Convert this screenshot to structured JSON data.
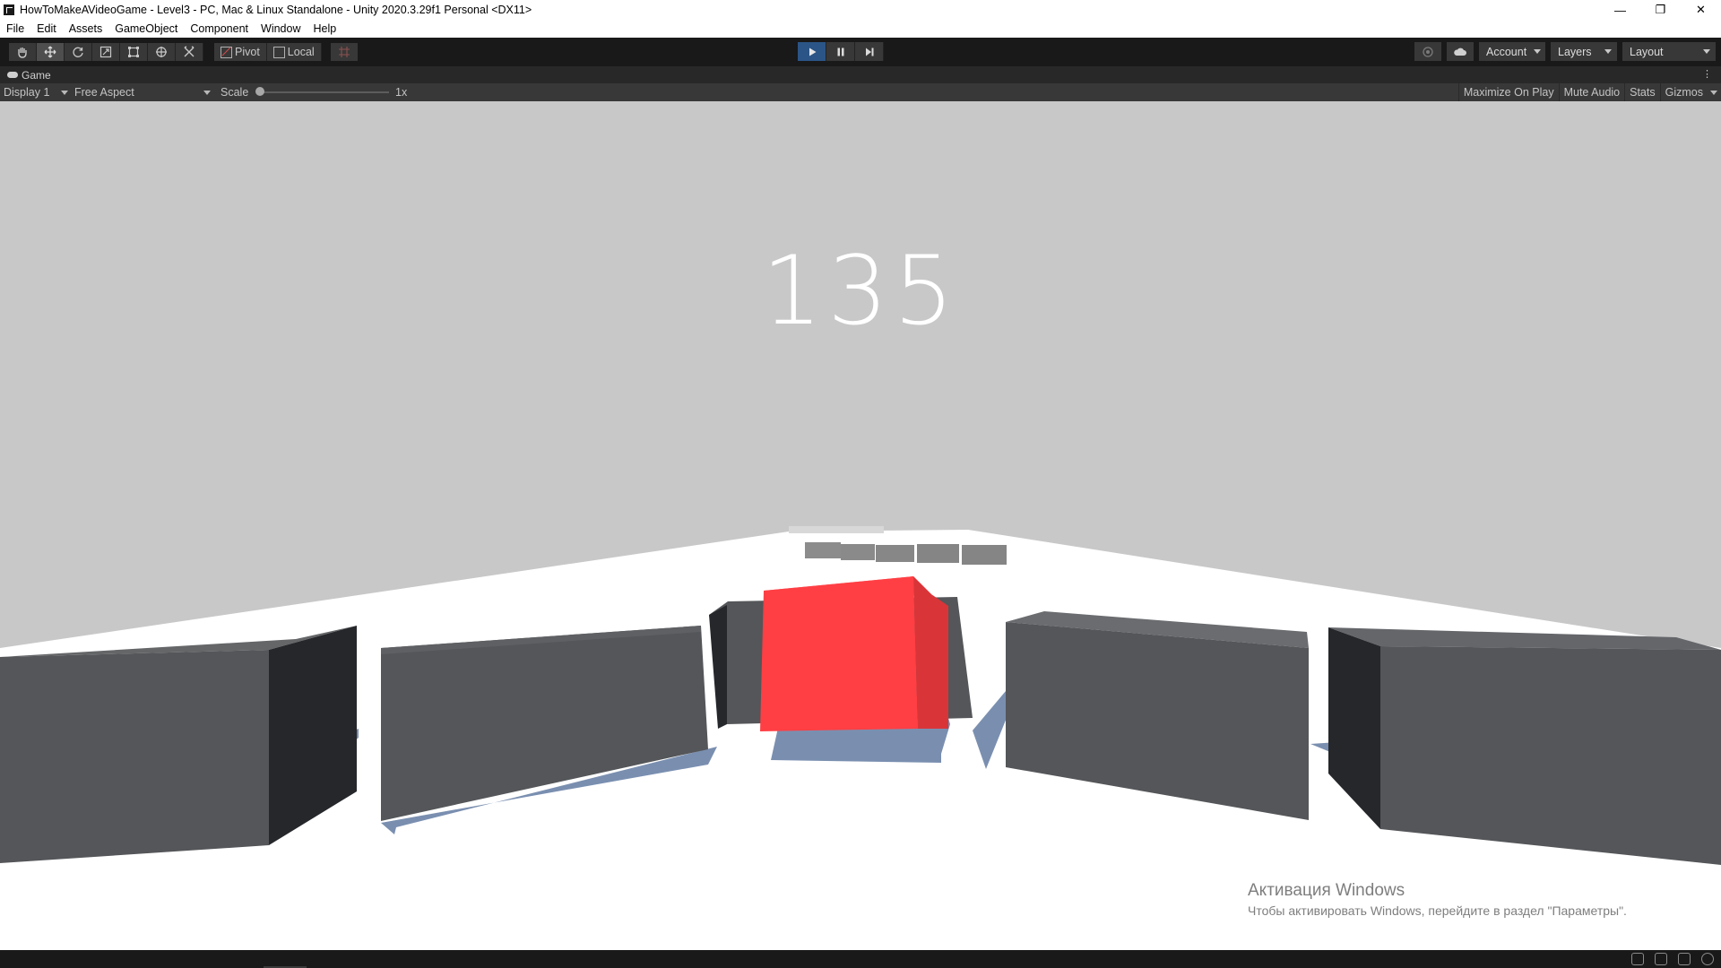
{
  "window": {
    "title": "HowToMakeAVideoGame - Level3 - PC, Mac & Linux Standalone - Unity 2020.3.29f1 Personal <DX11>",
    "controls": {
      "minimize": "—",
      "restore": "❐",
      "close": "✕"
    }
  },
  "menu": {
    "items": [
      "File",
      "Edit",
      "Assets",
      "GameObject",
      "Component",
      "Window",
      "Help"
    ]
  },
  "toolbar": {
    "tools": [
      "hand-tool-icon",
      "move-tool-icon",
      "rotate-tool-icon",
      "scale-tool-icon",
      "rect-tool-icon",
      "transform-tool-icon",
      "custom-tool-icon"
    ],
    "pivot_label": "Pivot",
    "local_label": "Local",
    "playmode": {
      "playing": true
    },
    "account_label": "Account",
    "layers_label": "Layers",
    "layout_label": "Layout"
  },
  "game_tab": {
    "label": "Game"
  },
  "game_toolbar": {
    "display_label": "Display 1",
    "aspect_label": "Free Aspect",
    "scale_label": "Scale",
    "scale_value": "1x",
    "maximize_label": "Maximize On Play",
    "mute_label": "Mute Audio",
    "stats_label": "Stats",
    "gizmos_label": "Gizmos"
  },
  "game": {
    "score": "135",
    "colors": {
      "sky": "#c8c8c8",
      "ground": "#ffffff",
      "player": "#ff3f44",
      "obstacle": "#545659",
      "shadow": "#7a8fb0"
    }
  },
  "watermark": {
    "title": "Активация Windows",
    "subtitle": "Чтобы активировать Windows, перейдите в раздел \"Параметры\"."
  }
}
